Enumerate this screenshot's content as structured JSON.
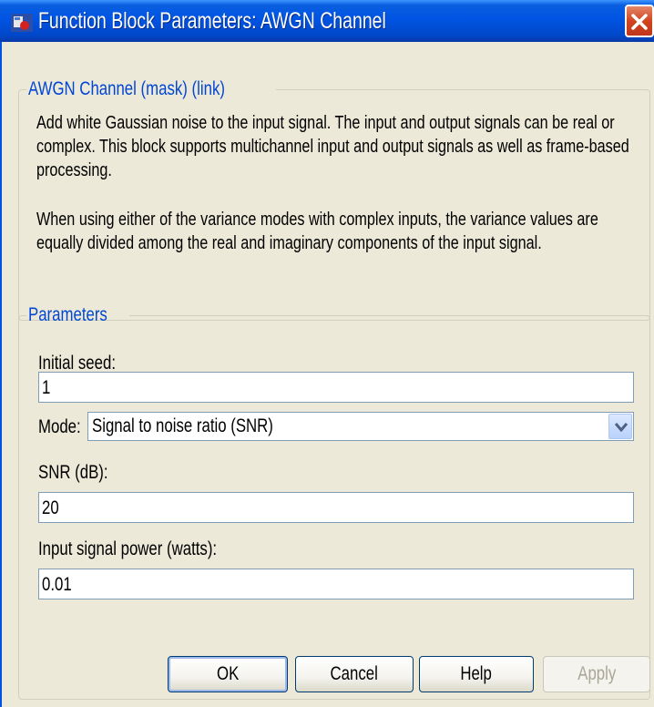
{
  "window": {
    "title": "Function Block Parameters: AWGN Channel"
  },
  "description": {
    "group_label": "AWGN Channel (mask) (link)",
    "paragraph_1": "Add white Gaussian noise to the input signal. The input and output signals can be real or complex. This block supports multichannel input and output signals as well as frame-based processing.",
    "paragraph_2": "When using either of the variance modes with complex inputs, the variance values are equally divided among the real and imaginary components of the input signal."
  },
  "parameters": {
    "group_label": "Parameters",
    "initial_seed": {
      "label": "Initial seed:",
      "value": "1"
    },
    "mode": {
      "label": "Mode:",
      "value": "Signal to noise ratio  (SNR)"
    },
    "snr": {
      "label": "SNR (dB):",
      "value": "20"
    },
    "input_power": {
      "label": "Input signal power (watts):",
      "value": "0.01"
    }
  },
  "buttons": {
    "ok": "OK",
    "cancel": "Cancel",
    "help": "Help",
    "apply": "Apply"
  },
  "icons": {
    "app": "simulink-block-icon",
    "close": "close-icon",
    "dropdown": "chevron-down-icon"
  },
  "colors": {
    "titlebar": "#0054e3",
    "group_label": "#0046d5",
    "dialog_bg": "#ece9d8",
    "close_button": "#d1451f"
  }
}
